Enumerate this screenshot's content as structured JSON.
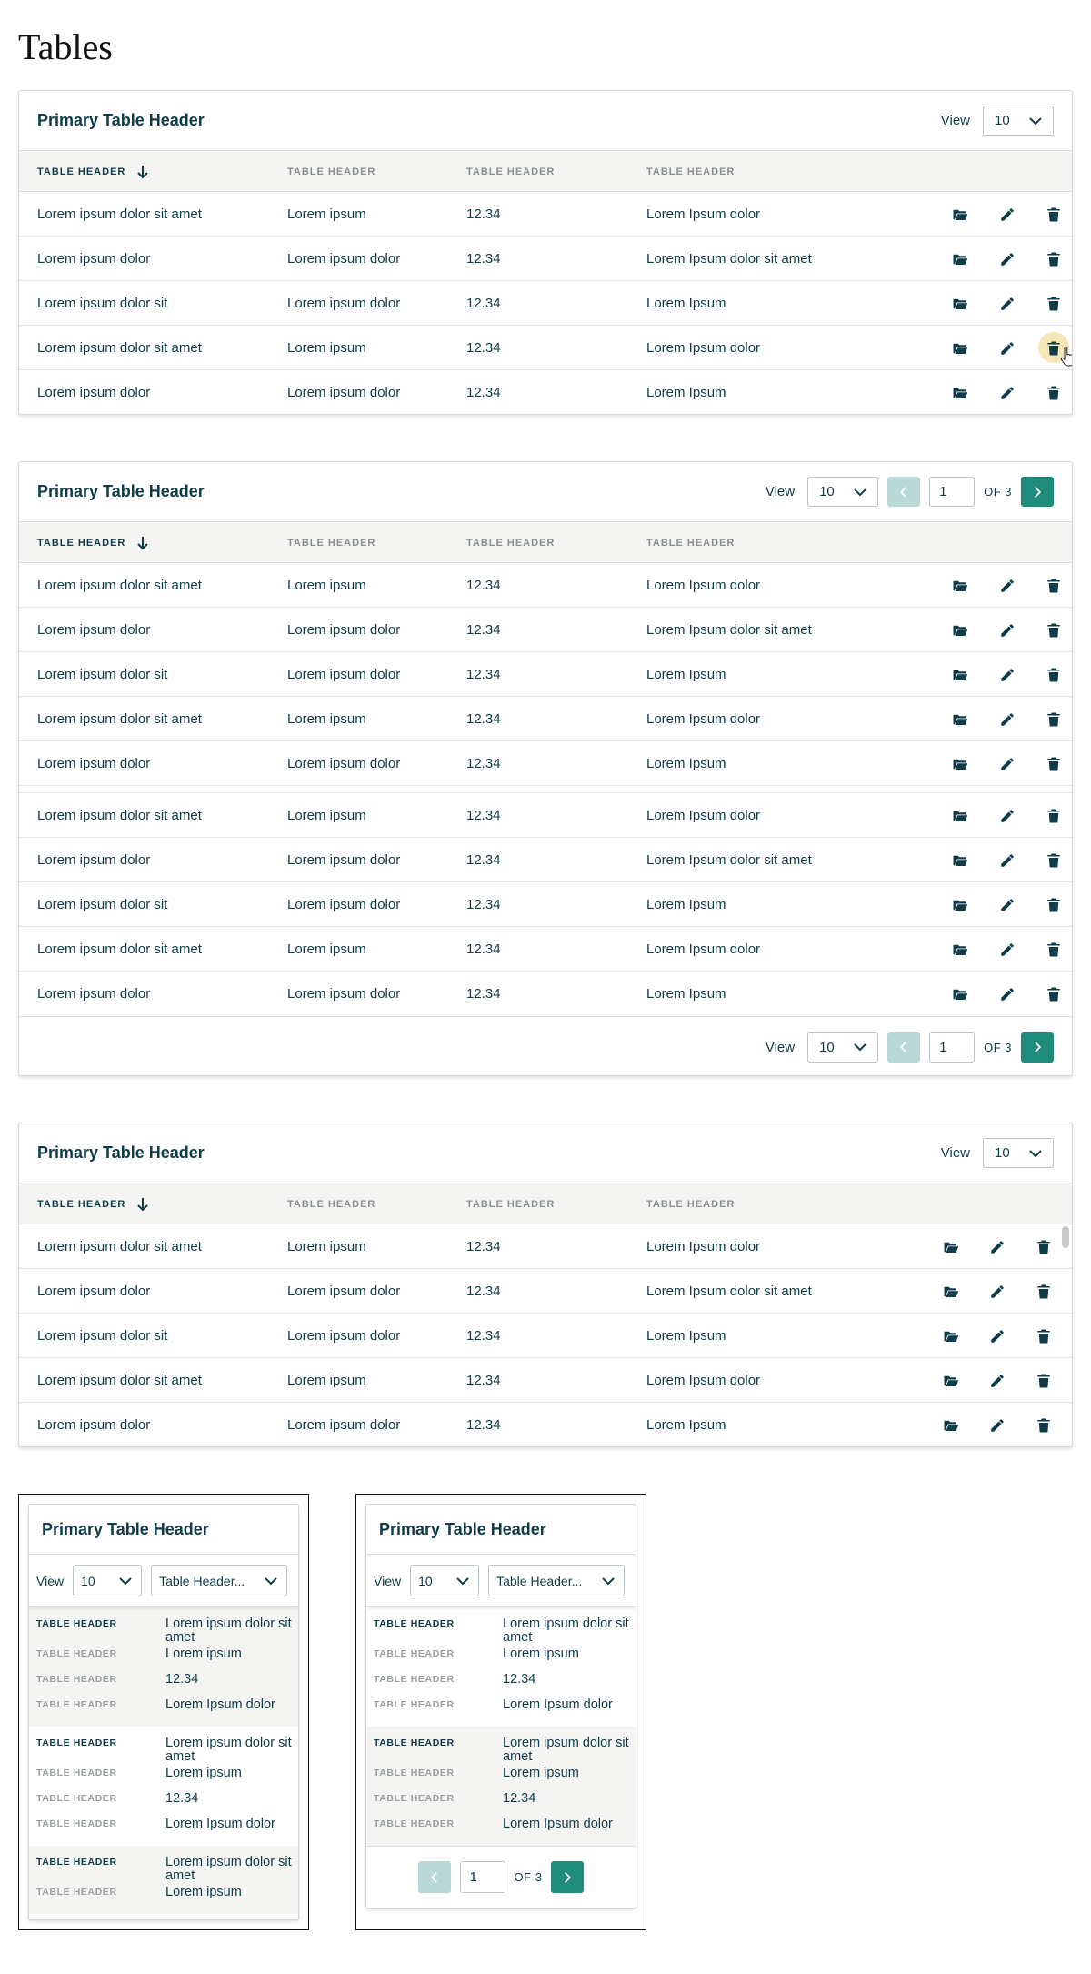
{
  "page": {
    "title": "Tables"
  },
  "colors": {
    "text": "#0f3c48",
    "accent": "#1f8b7a",
    "accent_disabled": "#b8d9d5",
    "hover": "#f6e6b8",
    "header_bg": "#f4f4f2"
  },
  "table": {
    "title": "Primary Table Header",
    "view_label": "View",
    "view_value": "10",
    "page_value": "1",
    "page_of": "OF 3",
    "headers": [
      "TABLE HEADER",
      "TABLE HEADER",
      "TABLE HEADER",
      "TABLE HEADER"
    ],
    "rows": [
      [
        "Lorem ipsum dolor sit amet",
        "Lorem ipsum",
        "12.34",
        "Lorem Ipsum dolor"
      ],
      [
        "Lorem ipsum dolor",
        "Lorem ipsum dolor",
        "12.34",
        "Lorem Ipsum dolor sit amet"
      ],
      [
        "Lorem ipsum dolor sit",
        "Lorem ipsum dolor",
        "12.34",
        "Lorem Ipsum"
      ],
      [
        "Lorem ipsum dolor sit amet",
        "Lorem ipsum",
        "12.34",
        "Lorem Ipsum dolor"
      ],
      [
        "Lorem ipsum dolor",
        "Lorem ipsum dolor",
        "12.34",
        "Lorem Ipsum"
      ]
    ],
    "icons": {
      "open": "folder-open-icon",
      "edit": "pencil-icon",
      "delete": "trash-icon",
      "sort": "arrow-down-icon",
      "prev": "chevron-left-icon",
      "next": "chevron-right-icon",
      "dropdown": "chevron-down-icon"
    }
  },
  "mobile": {
    "column_select": "Table Header...",
    "records": [
      {
        "primary": "Lorem ipsum dolor sit amet",
        "b": "Lorem ipsum",
        "c": "12.34",
        "d": "Lorem Ipsum dolor"
      },
      {
        "primary": "Lorem ipsum dolor sit amet",
        "b": "Lorem ipsum",
        "c": "12.34",
        "d": "Lorem Ipsum dolor"
      },
      {
        "primary": "Lorem ipsum dolor sit amet",
        "b": "Lorem ipsum",
        "c": "",
        "d": ""
      }
    ]
  }
}
